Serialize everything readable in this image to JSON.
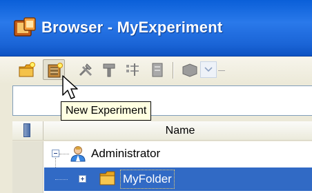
{
  "window": {
    "title": "Browser - MyExperiment"
  },
  "toolbar": {
    "buttons": [
      {
        "icon": "new-folder-icon"
      },
      {
        "icon": "new-experiment-icon",
        "state": "hovered"
      },
      {
        "icon": "tools-icon"
      },
      {
        "icon": "hammer-icon"
      },
      {
        "icon": "properties-icon"
      },
      {
        "icon": "document-icon"
      },
      {
        "icon": "module-icon"
      },
      {
        "icon": "dropdown-chevron-icon"
      }
    ]
  },
  "tooltip": {
    "text": "New Experiment"
  },
  "columns": {
    "name": "Name"
  },
  "tree": {
    "nodes": [
      {
        "label": "Administrator",
        "icon": "user-icon",
        "expanded": true,
        "selected": false
      },
      {
        "label": "MyFolder",
        "icon": "folder-icon",
        "expanded": false,
        "selected": true
      }
    ]
  },
  "colors": {
    "titlebar": "#1a64d6",
    "selection": "#316ac5",
    "tooltip_bg": "#ffffe1"
  }
}
